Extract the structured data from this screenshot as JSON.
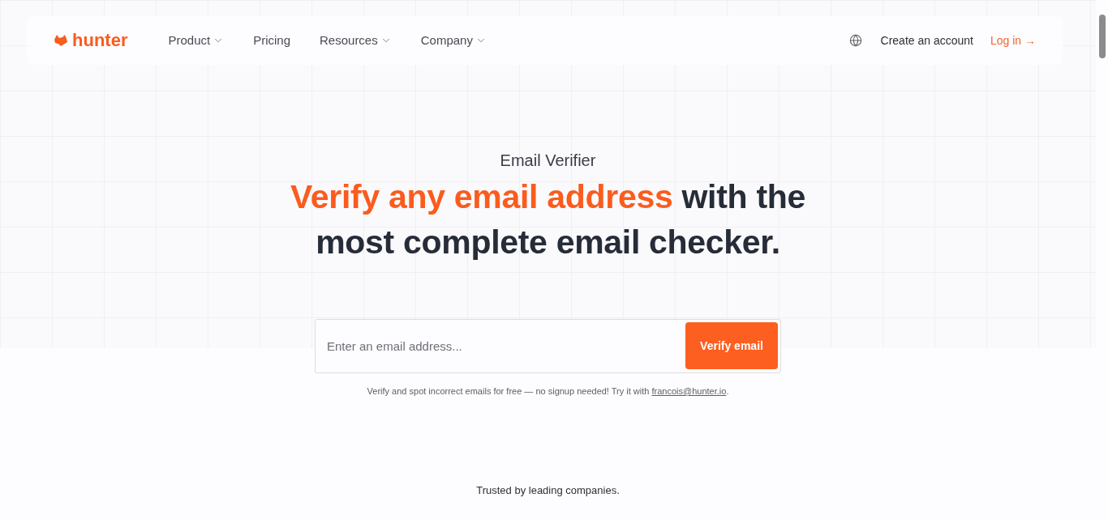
{
  "nav": {
    "logo": "hunter",
    "items": [
      {
        "label": "Product",
        "dropdown": true
      },
      {
        "label": "Pricing",
        "dropdown": false
      },
      {
        "label": "Resources",
        "dropdown": true
      },
      {
        "label": "Company",
        "dropdown": true
      }
    ],
    "create_account": "Create an account",
    "login": "Log in →"
  },
  "hero": {
    "eyebrow": "Email Verifier",
    "heading_highlight": "Verify any email address",
    "heading_rest": "with the most complete email checker.",
    "input": {
      "placeholder": "Enter an email address..."
    },
    "button": "Verify email",
    "note": {
      "text": "Verify and spot incorrect emails for free — no signup needed! Try it with",
      "link": "francois@hunter.io",
      "end": "."
    }
  },
  "trusted": "Trusted by leading companies."
}
